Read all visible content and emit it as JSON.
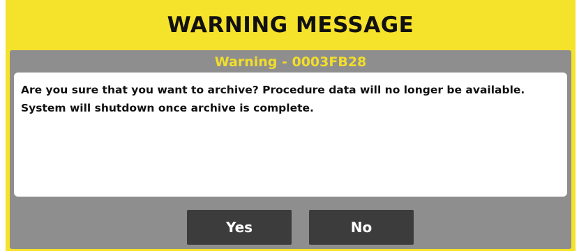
{
  "dialog": {
    "title": "WARNING MESSAGE",
    "subtitle": "Warning - 0003FB28",
    "message_line1": "Are you sure that you want to archive? Procedure data will no longer be available.",
    "message_line2": "System will shutdown once archive is complete.",
    "yes_label": "Yes",
    "no_label": "No"
  },
  "colors": {
    "frame": "#f5e22a",
    "panel": "#8e8e8e",
    "subtitle": "#f2de2a",
    "button": "#3c3c3c"
  }
}
